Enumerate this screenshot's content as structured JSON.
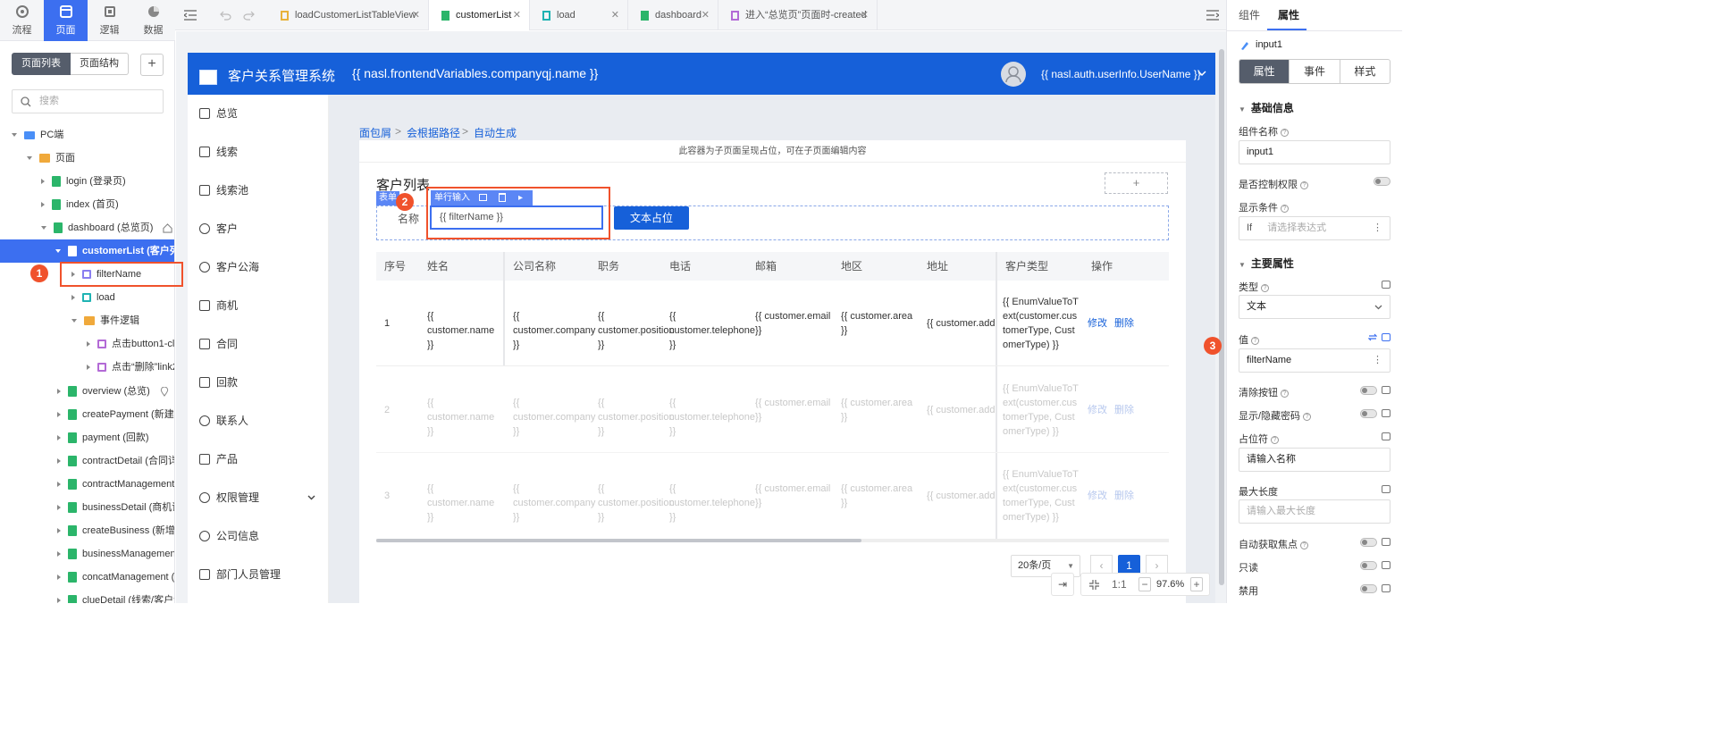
{
  "nav": {
    "items": [
      {
        "label": "流程",
        "icon": "flow-icon"
      },
      {
        "label": "页面",
        "icon": "page-icon"
      },
      {
        "label": "逻辑",
        "icon": "logic-icon"
      },
      {
        "label": "数据",
        "icon": "data-icon"
      }
    ]
  },
  "leftpanel": {
    "seg_page_list": "页面列表",
    "seg_page_structure": "页面结构",
    "add": "+",
    "search_placeholder": "搜索",
    "tree": [
      {
        "label": "PC端"
      },
      {
        "label": "页面"
      },
      {
        "label": "login (登录页)"
      },
      {
        "label": "index (首页)"
      },
      {
        "label": "dashboard (总览页)"
      },
      {
        "label": "customerList (客户列表"
      },
      {
        "label": "filterName"
      },
      {
        "label": "load"
      },
      {
        "label": "事件逻辑"
      },
      {
        "label": "点击button1-cli"
      },
      {
        "label": "点击“删除”link2"
      },
      {
        "label": "overview (总览)"
      },
      {
        "label": "createPayment (新建回"
      },
      {
        "label": "payment (回款)"
      },
      {
        "label": "contractDetail (合同详"
      },
      {
        "label": "contractManagement ("
      },
      {
        "label": "businessDetail (商机详"
      },
      {
        "label": "createBusiness (新增商"
      },
      {
        "label": "businessManagement"
      },
      {
        "label": "concatManagement (联"
      },
      {
        "label": "clueDetail (线索/客户详"
      }
    ]
  },
  "tabs": [
    {
      "label": "loadCustomerListTableView"
    },
    {
      "label": "customerList"
    },
    {
      "label": "load"
    },
    {
      "label": "dashboard"
    },
    {
      "label": "进入“总览页”页面时-created"
    }
  ],
  "app": {
    "title": "客户关系管理系统",
    "company_expr": "{{ nasl.frontendVariables.companyqj.name }}",
    "user_expr": "{{ nasl.auth.userInfo.UserName }}",
    "menu": [
      "总览",
      "线索",
      "线索池",
      "客户",
      "客户公海",
      "商机",
      "合同",
      "回款",
      "联系人",
      "产品",
      "权限管理",
      "公司信息",
      "部门人员管理"
    ],
    "breadcrumb": [
      "面包屑",
      "会根据路径",
      "自动生成"
    ],
    "placeholder_banner": "此容器为子页面呈现占位，可在子页面编辑内容",
    "page_title": "客户列表",
    "form_tag": "表单",
    "input_tag": "单行输入",
    "form_label": "名称",
    "input_value": "{{ filterName }}",
    "button_label": "文本占位",
    "columns": [
      "序号",
      "姓名",
      "公司名称",
      "职务",
      "电话",
      "邮箱",
      "地区",
      "地址",
      "客户类型",
      "操作"
    ],
    "rows": [
      {
        "idx": "1",
        "name": "{{ customer.name }}",
        "company": "{{ customer.company }}",
        "position": "{{ customer.position }}",
        "phone": "{{ customer.telephone }}",
        "email": "{{ customer.email }}",
        "area": "{{ customer.area }}",
        "addr": "{{ customer.add",
        "type": "{{ EnumValueToText(customer.customerType, CustomerType) }}",
        "edit": "修改",
        "del": "删除"
      },
      {
        "idx": "2",
        "name": "{{ customer.name }}",
        "company": "{{ customer.company }}",
        "position": "{{ customer.position }}",
        "phone": "{{ customer.telephone }}",
        "email": "{{ customer.email }}",
        "area": "{{ customer.area }}",
        "addr": "{{ customer.add",
        "type": "{{ EnumValueToText(customer.customerType, CustomerType) }}",
        "edit": "修改",
        "del": "删除"
      },
      {
        "idx": "3",
        "name": "{{ customer.name }}",
        "company": "{{ customer.company }}",
        "position": "{{ customer.position }}",
        "phone": "{{ customer.telephone }}",
        "email": "{{ customer.email }}",
        "area": "{{ customer.area }}",
        "addr": "{{ customer.add",
        "type": "{{ EnumValueToText(customer.customerType, CustomerType) }}",
        "edit": "修改",
        "del": "删除"
      }
    ],
    "page_size": "20条/页",
    "current_page": "1"
  },
  "zoom": {
    "fit": "1:1",
    "minus": "−",
    "value": "97.6%",
    "plus": "+"
  },
  "annotations": {
    "b1": "1",
    "b2": "2",
    "b3": "3"
  },
  "rightpanel": {
    "tab_component": "组件",
    "tab_property": "属性",
    "component_name": "input1",
    "sub_tabs": [
      "属性",
      "事件",
      "样式"
    ],
    "section_basic": "基础信息",
    "label_component_name": "组件名称",
    "component_name_value": "input1",
    "label_permission": "是否控制权限",
    "label_condition": "显示条件",
    "condition_prefix": "If",
    "condition_placeholder": "请选择表达式",
    "section_main": "主要属性",
    "label_type": "类型",
    "type_value": "文本",
    "label_value": "值",
    "value_value": "filterName",
    "label_clear": "清除按钮",
    "label_password": "显示/隐藏密码",
    "label_placeholder": "占位符",
    "placeholder_value": "请输入名称",
    "label_maxlength": "最大长度",
    "maxlength_placeholder": "请输入最大长度",
    "label_autofocus": "自动获取焦点",
    "label_readonly": "只读",
    "label_disabled": "禁用"
  },
  "colors": {
    "accent": "#3c6ff0",
    "header": "#1660d9",
    "annotation": "#f0522c"
  }
}
